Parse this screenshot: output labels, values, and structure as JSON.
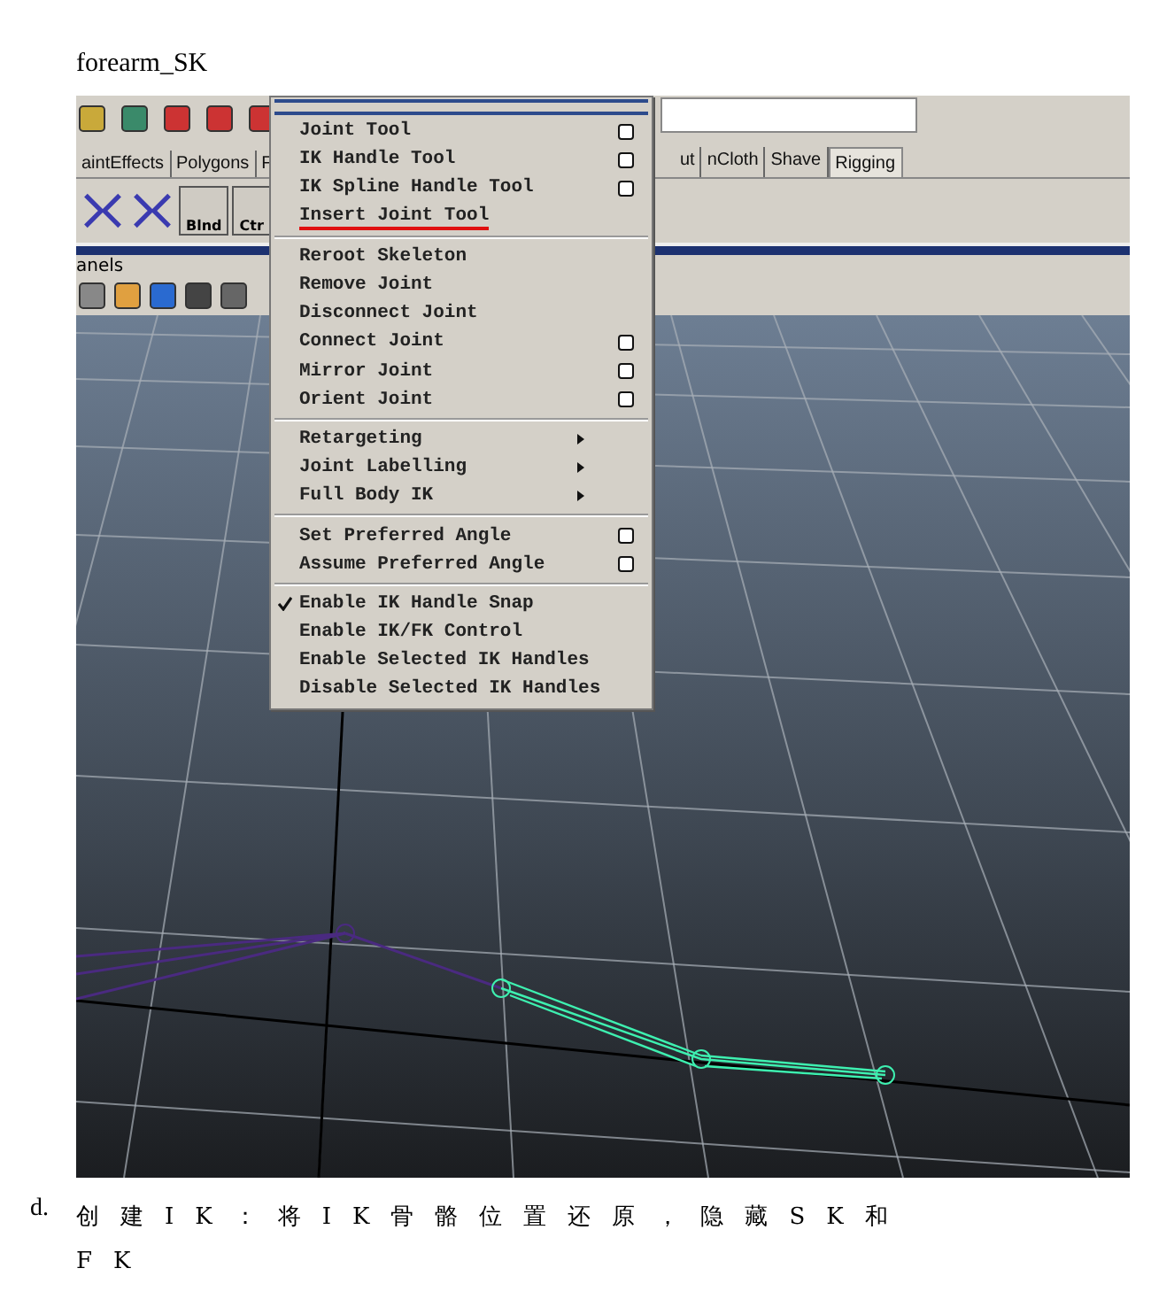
{
  "caption": "forearm_SK",
  "shelf_tabs": [
    {
      "label": "aintEffects",
      "selected": false
    },
    {
      "label": "Polygons",
      "selected": false
    },
    {
      "label": "F",
      "selected": false
    }
  ],
  "shelf_tabs_right": [
    {
      "label": "ut",
      "selected": false
    },
    {
      "label": "nCloth",
      "selected": false
    },
    {
      "label": "Shave",
      "selected": false
    },
    {
      "label": "Rigging",
      "selected": true
    }
  ],
  "shelf_items": [
    {
      "kind": "icon"
    },
    {
      "kind": "icon"
    },
    {
      "kind": "labeled",
      "label": "Blnd"
    },
    {
      "kind": "labeled",
      "label": "Ctr"
    }
  ],
  "panel_menu": "anels",
  "menu": [
    [
      {
        "label": "Joint Tool",
        "option_box": true,
        "submenu": false,
        "checked": false,
        "annotated": false
      },
      {
        "label": "IK Handle Tool",
        "option_box": true,
        "submenu": false,
        "checked": false,
        "annotated": false
      },
      {
        "label": "IK Spline Handle Tool",
        "option_box": true,
        "submenu": false,
        "checked": false,
        "annotated": false
      },
      {
        "label": "Insert Joint Tool",
        "option_box": false,
        "submenu": false,
        "checked": false,
        "annotated": true
      }
    ],
    [
      {
        "label": "Reroot Skeleton",
        "option_box": false,
        "submenu": false,
        "checked": false,
        "annotated": false
      },
      {
        "label": "Remove Joint",
        "option_box": false,
        "submenu": false,
        "checked": false,
        "annotated": false
      },
      {
        "label": "Disconnect Joint",
        "option_box": false,
        "submenu": false,
        "checked": false,
        "annotated": false
      },
      {
        "label": "Connect Joint",
        "option_box": true,
        "submenu": false,
        "checked": false,
        "annotated": false
      },
      {
        "label": "Mirror Joint",
        "option_box": true,
        "submenu": false,
        "checked": false,
        "annotated": false
      },
      {
        "label": "Orient Joint",
        "option_box": true,
        "submenu": false,
        "checked": false,
        "annotated": false
      }
    ],
    [
      {
        "label": "Retargeting",
        "option_box": false,
        "submenu": true,
        "checked": false,
        "annotated": false
      },
      {
        "label": "Joint Labelling",
        "option_box": false,
        "submenu": true,
        "checked": false,
        "annotated": false
      },
      {
        "label": "Full Body IK",
        "option_box": false,
        "submenu": true,
        "checked": false,
        "annotated": false
      }
    ],
    [
      {
        "label": "Set Preferred Angle",
        "option_box": true,
        "submenu": false,
        "checked": false,
        "annotated": false
      },
      {
        "label": "Assume Preferred Angle",
        "option_box": true,
        "submenu": false,
        "checked": false,
        "annotated": false
      }
    ],
    [
      {
        "label": "Enable IK Handle Snap",
        "option_box": false,
        "submenu": false,
        "checked": true,
        "annotated": false
      },
      {
        "label": "Enable IK/FK Control",
        "option_box": false,
        "submenu": false,
        "checked": false,
        "annotated": false
      },
      {
        "label": "Enable Selected IK Handles",
        "option_box": false,
        "submenu": false,
        "checked": false,
        "annotated": false
      },
      {
        "label": "Disable Selected IK Handles",
        "option_box": false,
        "submenu": false,
        "checked": false,
        "annotated": false
      }
    ]
  ],
  "step": {
    "marker": "d.",
    "text": "创建IK：将IK骨骼位置还原，隐藏SK和FK"
  }
}
